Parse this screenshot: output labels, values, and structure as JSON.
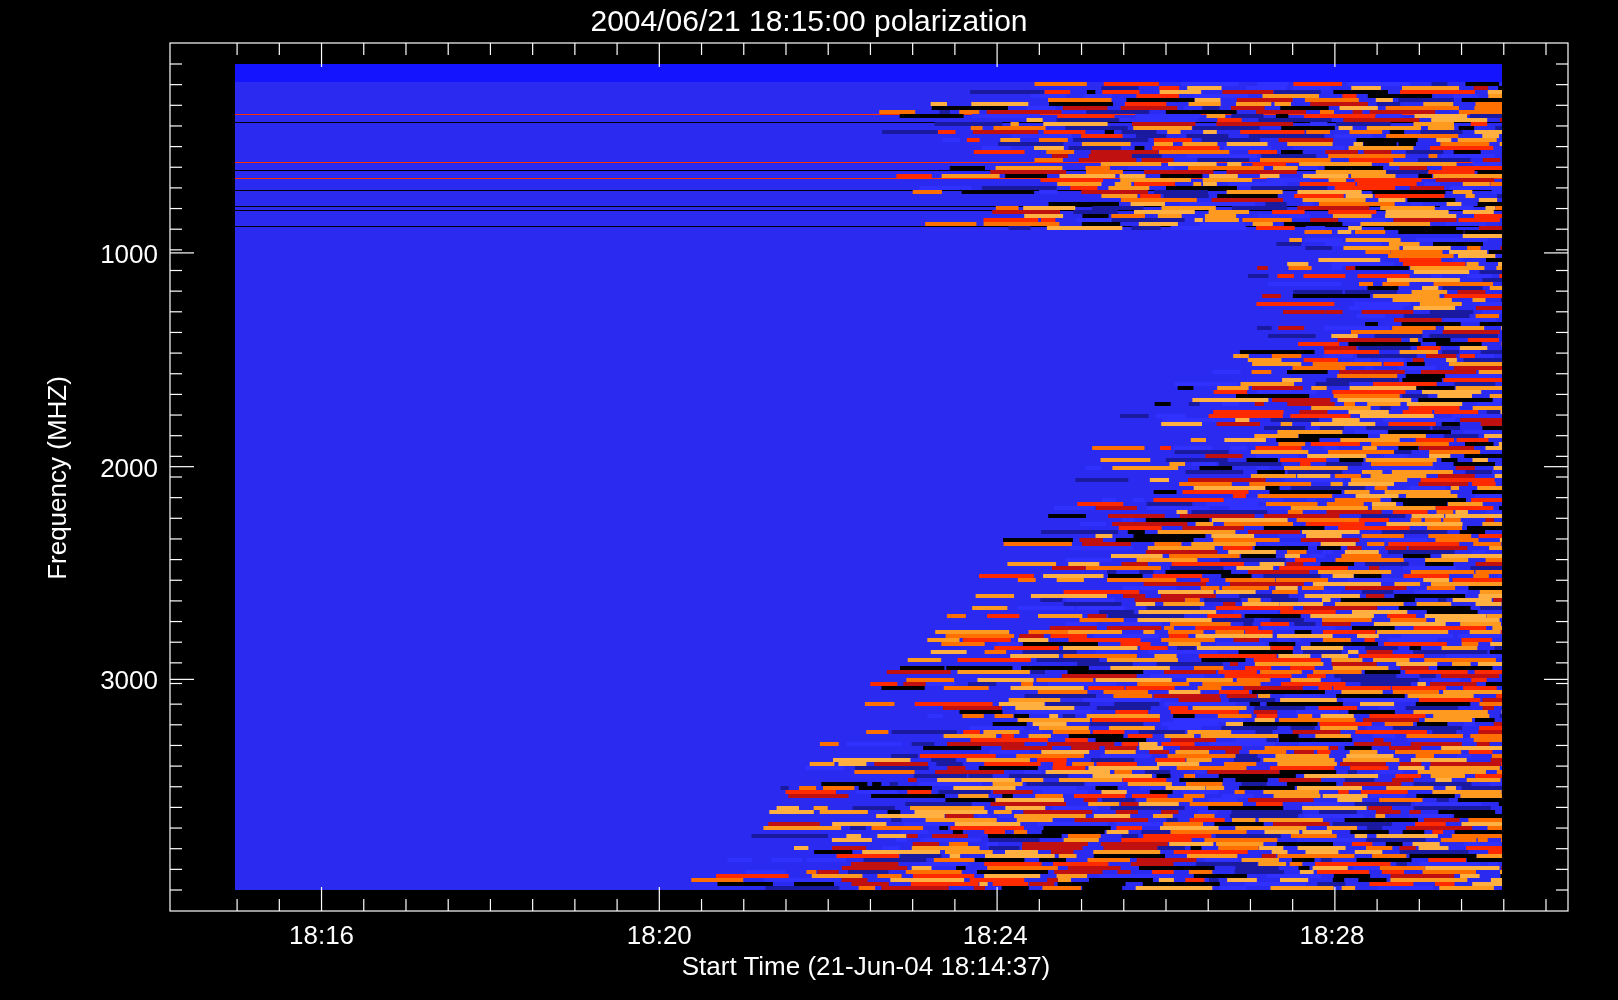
{
  "plot": {
    "title": "2004/06/21 18:15:00 polarization",
    "xlabel": "Start Time (21-Jun-04 18:14:37)",
    "ylabel": "Frequency (MHZ)",
    "xticks": [
      "18:16",
      "18:20",
      "18:24",
      "18:28"
    ],
    "yticks": [
      "1000",
      "2000",
      "3000"
    ]
  }
}
